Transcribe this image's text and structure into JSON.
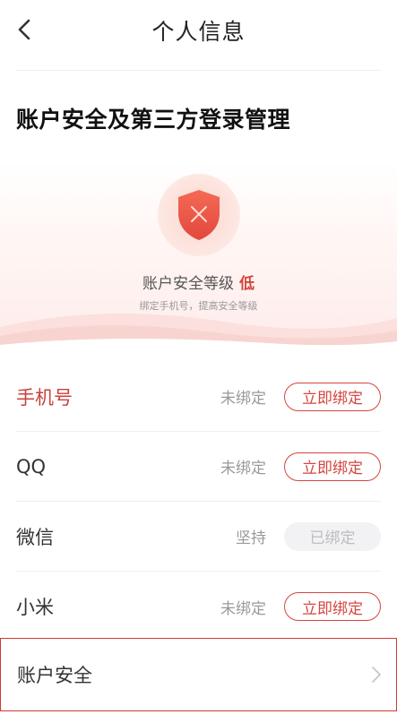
{
  "header": {
    "title": "个人信息"
  },
  "section": {
    "title": "账户安全及第三方登录管理"
  },
  "security": {
    "level_label": "账户安全等级",
    "level_value": "低",
    "hint": "绑定手机号，提高安全等级",
    "accent_color": "#d1453b"
  },
  "bindings": [
    {
      "label": "手机号",
      "status": "未绑定",
      "action": "立即绑定",
      "bound": false
    },
    {
      "label": "QQ",
      "status": "未绑定",
      "action": "立即绑定",
      "bound": false
    },
    {
      "label": "微信",
      "status": "坚持",
      "action": "已绑定",
      "bound": true
    },
    {
      "label": "小米",
      "status": "未绑定",
      "action": "立即绑定",
      "bound": false
    }
  ],
  "account_security": {
    "label": "账户安全"
  },
  "icons": {
    "back": "chevron-left-icon",
    "shield": "shield-x-icon",
    "row_arrow": "chevron-right-icon"
  }
}
